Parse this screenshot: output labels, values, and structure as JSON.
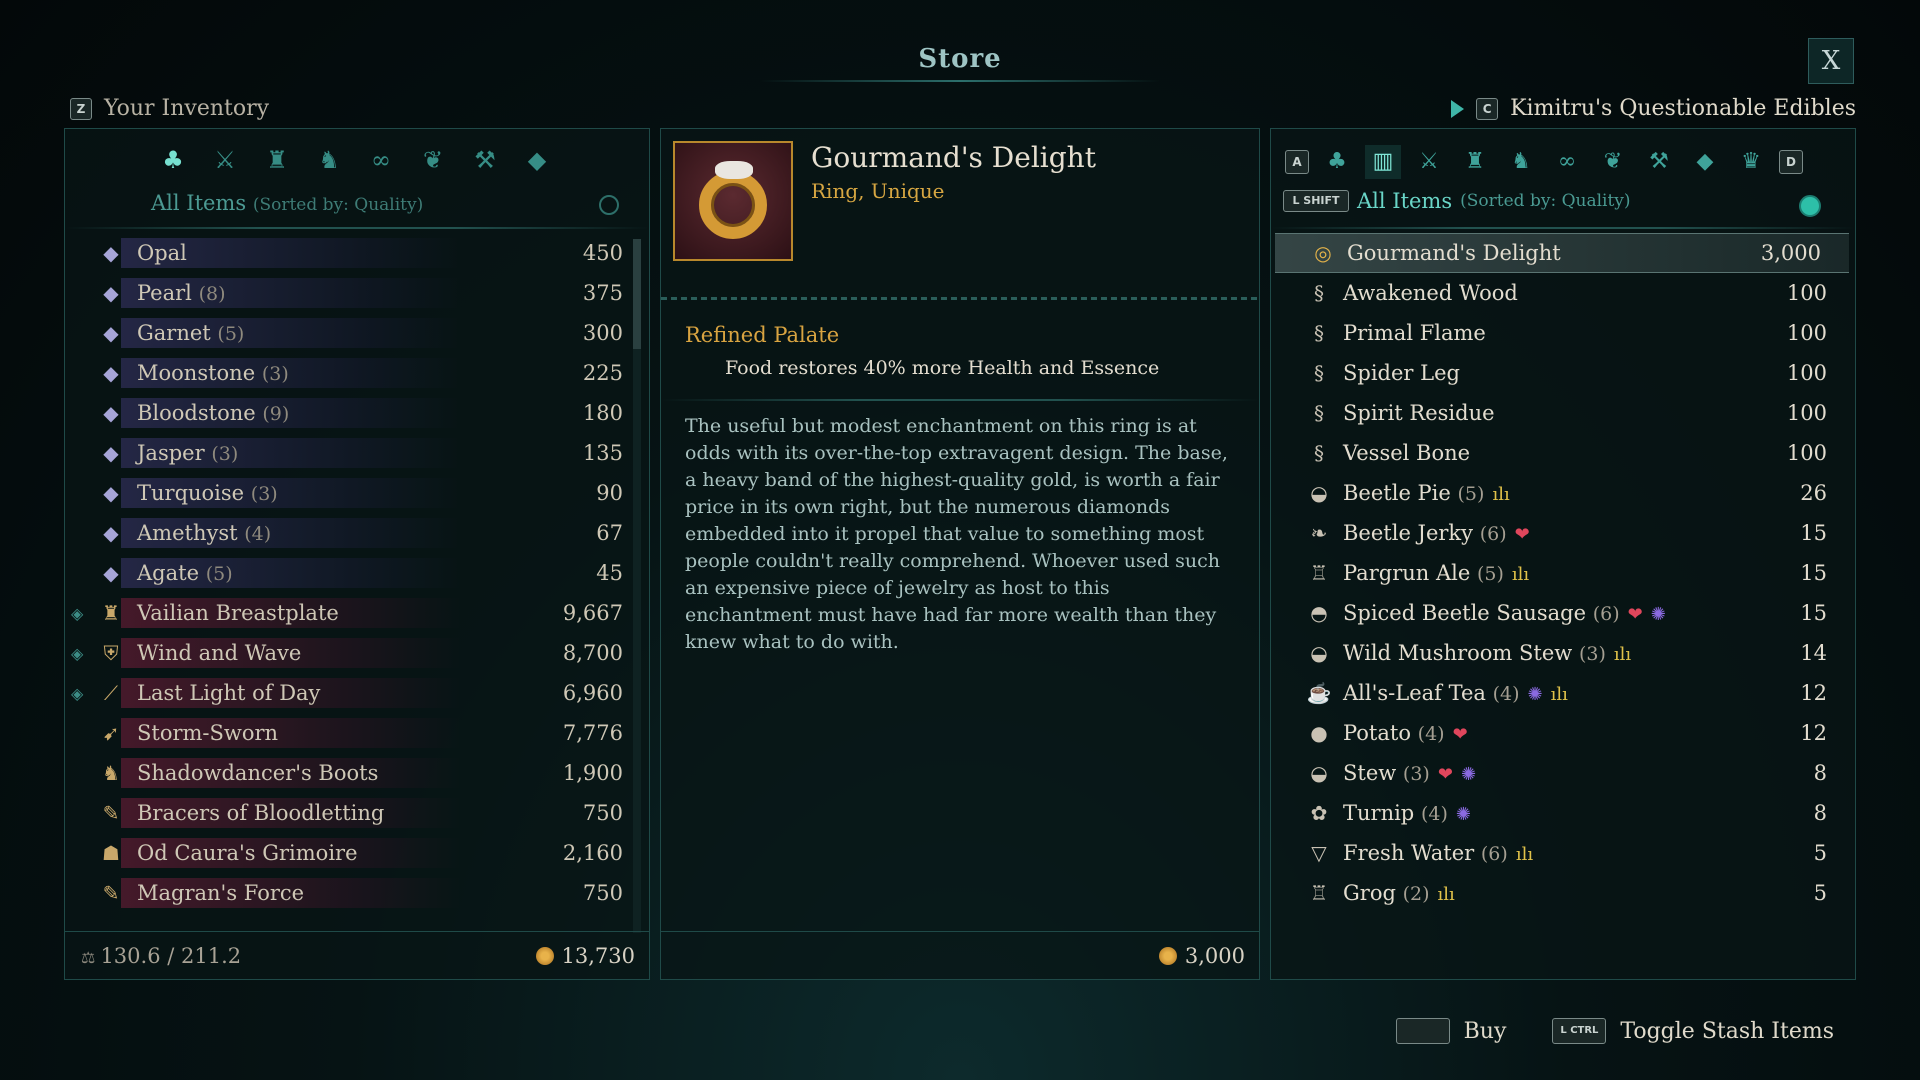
{
  "store": {
    "title": "Store",
    "close_label": "X"
  },
  "inventory": {
    "key": "Z",
    "title": "Your Inventory",
    "sort_label": "All Items",
    "sort_detail": "(Sorted by: Quality)",
    "items": [
      {
        "name": "Opal",
        "count": "",
        "price": "450",
        "icon": "gem-icon"
      },
      {
        "name": "Pearl",
        "count": "(8)",
        "price": "375",
        "icon": "gem-icon"
      },
      {
        "name": "Garnet",
        "count": "(5)",
        "price": "300",
        "icon": "gem-icon"
      },
      {
        "name": "Moonstone",
        "count": "(3)",
        "price": "225",
        "icon": "gem-icon"
      },
      {
        "name": "Bloodstone",
        "count": "(9)",
        "price": "180",
        "icon": "gem-icon"
      },
      {
        "name": "Jasper",
        "count": "(3)",
        "price": "135",
        "icon": "gem-icon"
      },
      {
        "name": "Turquoise",
        "count": "(3)",
        "price": "90",
        "icon": "gem-icon"
      },
      {
        "name": "Amethyst",
        "count": "(4)",
        "price": "67",
        "icon": "gem-icon"
      },
      {
        "name": "Agate",
        "count": "(5)",
        "price": "45",
        "icon": "gem-icon"
      },
      {
        "name": "Vailian Breastplate",
        "count": "",
        "price": "9,667",
        "icon": "armor-icon"
      },
      {
        "name": "Wind and Wave",
        "count": "",
        "price": "8,700",
        "icon": "shield-icon"
      },
      {
        "name": "Last Light of Day",
        "count": "",
        "price": "6,960",
        "icon": "sword-icon"
      },
      {
        "name": "Storm-Sworn",
        "count": "",
        "price": "7,776",
        "icon": "bow-icon"
      },
      {
        "name": "Shadowdancer's Boots",
        "count": "",
        "price": "1,900",
        "icon": "boots-icon"
      },
      {
        "name": "Bracers of Bloodletting",
        "count": "",
        "price": "750",
        "icon": "bracers-icon"
      },
      {
        "name": "Od Caura's Grimoire",
        "count": "",
        "price": "2,160",
        "icon": "grimoire-icon"
      },
      {
        "name": "Magran's Force",
        "count": "",
        "price": "750",
        "icon": "bracers-icon"
      }
    ],
    "weight": "130.6 / 211.2",
    "gold": "13,730"
  },
  "detail": {
    "name": "Gourmand's Delight",
    "subtitle": "Ring, Unique",
    "trait_title": "Refined Palate",
    "trait_desc": "Food restores 40% more Health and Essence",
    "description": "The useful but modest enchantment on this ring is at odds with its over-the-top extravagent design. The base, a heavy band of the highest-quality gold, is worth a fair price in its own right, but the numerous diamonds embedded into it propel that value to something most people couldn't really comprehend. Whoever used such an expensive piece of jewelry as host to this enchantment must have had far more wealth than they knew what to do with.",
    "price": "3,000"
  },
  "vendor": {
    "key": "C",
    "name": "Kimitru's Questionable Edibles",
    "tab_key_left": "A",
    "tab_key_right": "D",
    "sort_key": "L SHIFT",
    "sort_label": "All Items",
    "sort_detail": "(Sorted by: Quality)",
    "items": [
      {
        "name": "Gourmand's Delight",
        "count": "",
        "price": "3,000",
        "icon": "ring-icon",
        "effects": []
      },
      {
        "name": "Awakened Wood",
        "count": "",
        "price": "100",
        "icon": "scroll-icon",
        "effects": []
      },
      {
        "name": "Primal Flame",
        "count": "",
        "price": "100",
        "icon": "scroll-icon",
        "effects": []
      },
      {
        "name": "Spider Leg",
        "count": "",
        "price": "100",
        "icon": "scroll-icon",
        "effects": []
      },
      {
        "name": "Spirit Residue",
        "count": "",
        "price": "100",
        "icon": "scroll-icon",
        "effects": []
      },
      {
        "name": "Vessel Bone",
        "count": "",
        "price": "100",
        "icon": "scroll-icon",
        "effects": []
      },
      {
        "name": "Beetle Pie",
        "count": "(5)",
        "price": "26",
        "icon": "pie-icon",
        "effects": [
          "stamina"
        ]
      },
      {
        "name": "Beetle Jerky",
        "count": "(6)",
        "price": "15",
        "icon": "jerky-icon",
        "effects": [
          "health"
        ]
      },
      {
        "name": "Pargrun Ale",
        "count": "(5)",
        "price": "15",
        "icon": "ale-icon",
        "effects": [
          "stamina"
        ]
      },
      {
        "name": "Spiced Beetle Sausage",
        "count": "(6)",
        "price": "15",
        "icon": "sausage-icon",
        "effects": [
          "health",
          "essence"
        ]
      },
      {
        "name": "Wild Mushroom Stew",
        "count": "(3)",
        "price": "14",
        "icon": "stew-icon",
        "effects": [
          "stamina"
        ]
      },
      {
        "name": "All's-Leaf Tea",
        "count": "(4)",
        "price": "12",
        "icon": "tea-icon",
        "effects": [
          "essence",
          "stamina"
        ]
      },
      {
        "name": "Potato",
        "count": "(4)",
        "price": "12",
        "icon": "potato-icon",
        "effects": [
          "health"
        ]
      },
      {
        "name": "Stew",
        "count": "(3)",
        "price": "8",
        "icon": "stew-icon",
        "effects": [
          "health",
          "essence"
        ]
      },
      {
        "name": "Turnip",
        "count": "(4)",
        "price": "8",
        "icon": "turnip-icon",
        "effects": [
          "essence"
        ]
      },
      {
        "name": "Fresh Water",
        "count": "(6)",
        "price": "5",
        "icon": "water-icon",
        "effects": [
          "stamina"
        ]
      },
      {
        "name": "Grog",
        "count": "(2)",
        "price": "5",
        "icon": "ale-icon",
        "effects": [
          "stamina"
        ]
      }
    ]
  },
  "actions": {
    "buy_key": "",
    "buy_label": "Buy",
    "stash_key": "L CTRL",
    "stash_label": "Toggle Stash Items"
  }
}
